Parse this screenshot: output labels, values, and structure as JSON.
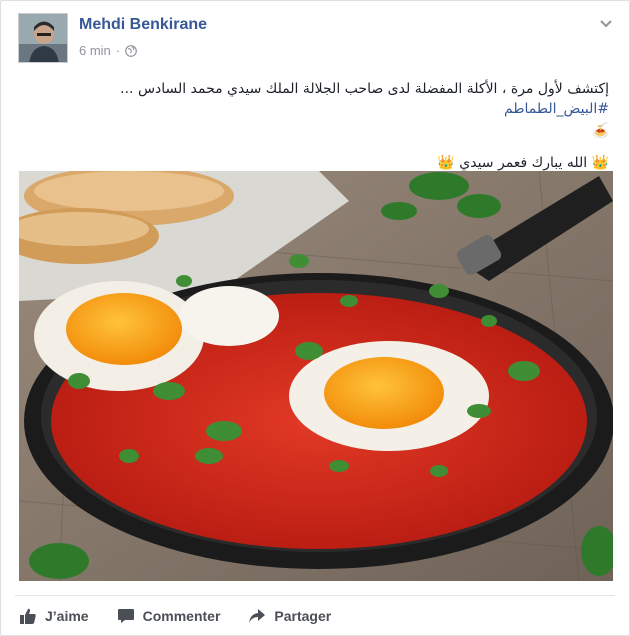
{
  "post": {
    "author": "Mehdi Benkirane",
    "timestamp": "6 min",
    "separator": "·",
    "privacy_icon": "globe-icon",
    "text_line1": "إكتشف لأول مرة ، الأكلة المفضلة لدى صاحب الجلالة الملك سيدي محمد السادس ...",
    "hashtag": "#البيض_الطماطم",
    "emoji_line": "🍝",
    "text_line3": "👑 الله يبارك فعمر سيدي 👑",
    "image_alt": "eggs-in-tomato-pan-photo"
  },
  "actions": {
    "like_label": "J’aime",
    "comment_label": "Commenter",
    "share_label": "Partager"
  },
  "colors": {
    "link": "#365899",
    "meta": "#90949c",
    "action": "#4b4f56"
  }
}
